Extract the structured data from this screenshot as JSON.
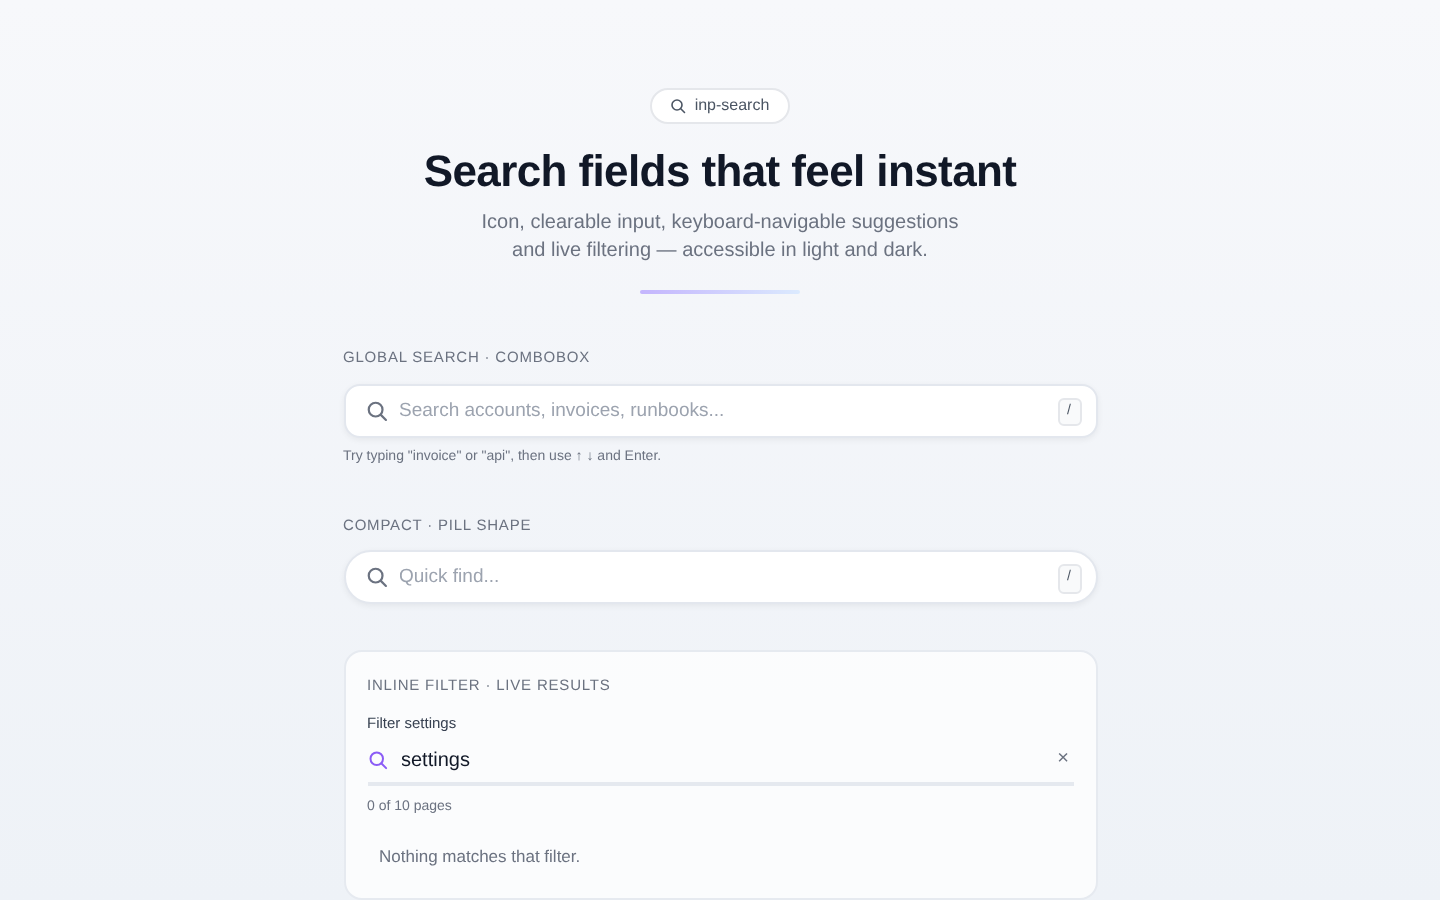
{
  "badge": {
    "label": "inp-search"
  },
  "title": "Search fields that feel instant",
  "subtitle": "Icon, clearable input, keyboard-navigable suggestions and live filtering — accessible in light and dark.",
  "sections": [
    {
      "kind": "box",
      "label": "GLOBAL SEARCH · COMBOBOX",
      "placeholder": "Search accounts, invoices, runbooks...",
      "shortcut": "/",
      "hint": "Try typing \"invoice\" or \"api\", then use ↑ ↓ and Enter."
    },
    {
      "kind": "pill",
      "label": "COMPACT · PILL SHAPE",
      "placeholder": "Quick find...",
      "shortcut": "/"
    },
    {
      "kind": "filter",
      "label": "INLINE FILTER · LIVE RESULTS",
      "field_label": "Filter settings",
      "value": "settings",
      "clear": "×",
      "count": "0 of 10 pages",
      "empty": "Nothing matches that filter."
    }
  ]
}
